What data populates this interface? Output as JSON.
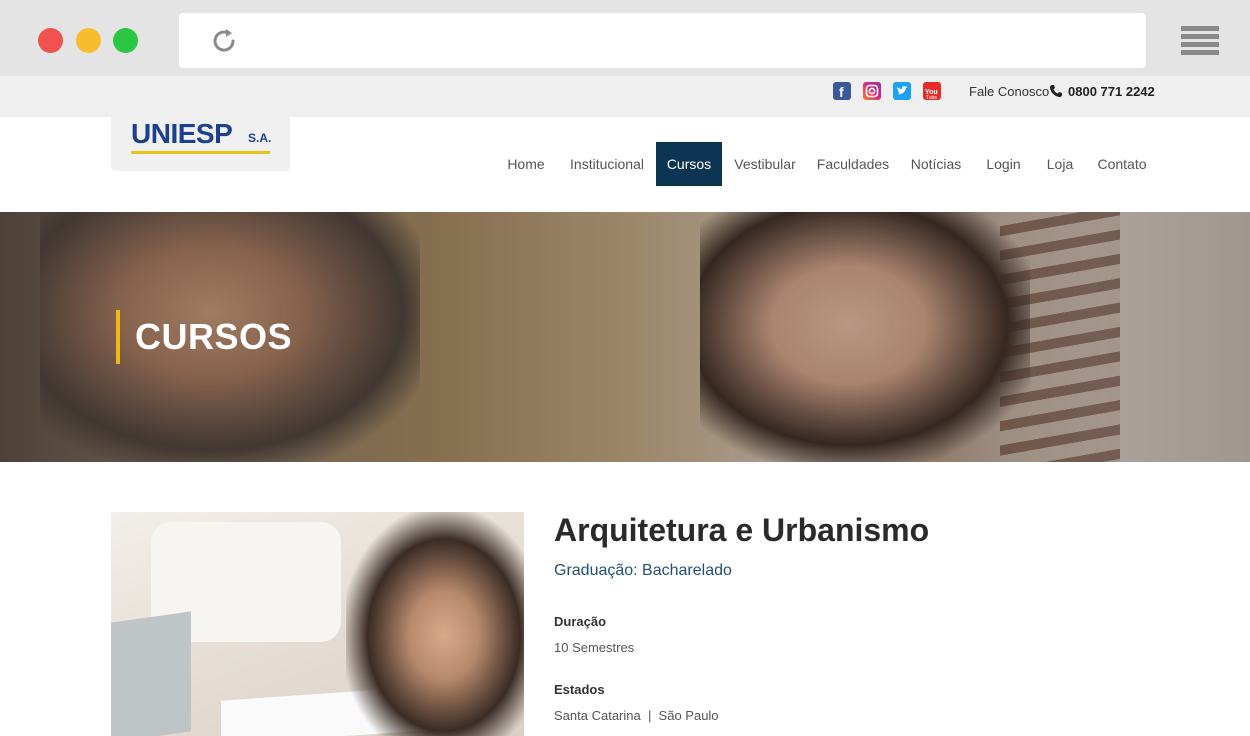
{
  "browser": {
    "reload_icon": "reload-icon",
    "menu_icon": "hamburger-menu-icon"
  },
  "topbar": {
    "social": [
      "facebook-icon",
      "instagram-icon",
      "twitter-icon",
      "youtube-icon"
    ],
    "contact_label": "Fale Conosco",
    "phone": "0800 771 2242"
  },
  "header": {
    "logo_main": "UNIESP",
    "logo_suffix": "S.A."
  },
  "nav": {
    "items": [
      {
        "label": "Home"
      },
      {
        "label": "Institucional"
      },
      {
        "label": "Cursos",
        "active": true
      },
      {
        "label": "Vestibular"
      },
      {
        "label": "Faculdades"
      },
      {
        "label": "Notícias"
      },
      {
        "label": "Login"
      },
      {
        "label": "Loja"
      },
      {
        "label": "Contato"
      }
    ]
  },
  "hero": {
    "title": "CURSOS"
  },
  "course": {
    "title": "Arquitetura e Urbanismo",
    "subtitle": "Graduação: Bacharelado",
    "duration_label": "Duração",
    "duration_value": "10 Semestres",
    "states_label": "Estados",
    "states_value": "Santa Catarina  |  São Paulo"
  },
  "colors": {
    "nav_active": "#0c3553",
    "accent_bar": "#f2b617",
    "subtitle": "#1f4f7a",
    "logo_blue": "#1c3f8e"
  }
}
